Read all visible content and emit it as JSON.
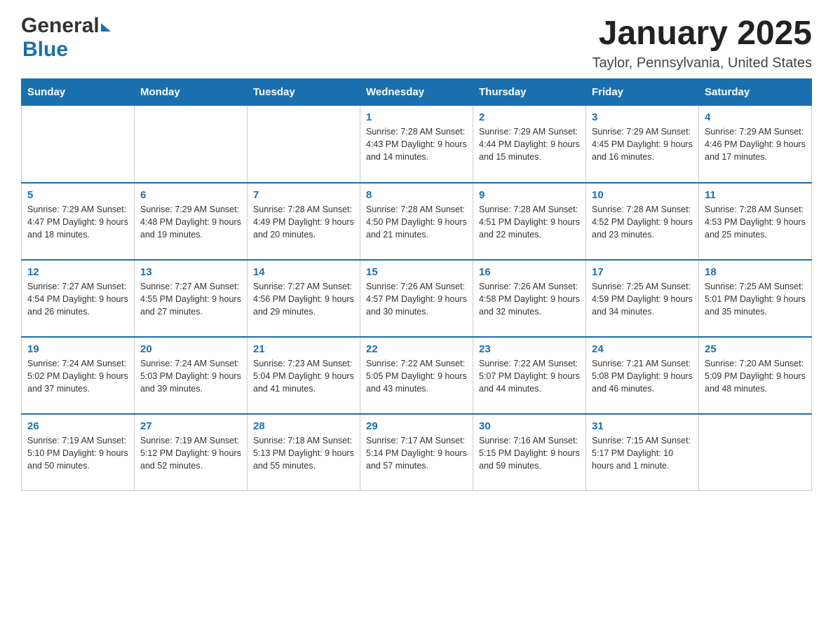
{
  "header": {
    "title": "January 2025",
    "subtitle": "Taylor, Pennsylvania, United States",
    "logo_general": "General",
    "logo_blue": "Blue"
  },
  "weekdays": [
    "Sunday",
    "Monday",
    "Tuesday",
    "Wednesday",
    "Thursday",
    "Friday",
    "Saturday"
  ],
  "weeks": [
    [
      {
        "day": "",
        "info": ""
      },
      {
        "day": "",
        "info": ""
      },
      {
        "day": "",
        "info": ""
      },
      {
        "day": "1",
        "info": "Sunrise: 7:28 AM\nSunset: 4:43 PM\nDaylight: 9 hours\nand 14 minutes."
      },
      {
        "day": "2",
        "info": "Sunrise: 7:29 AM\nSunset: 4:44 PM\nDaylight: 9 hours\nand 15 minutes."
      },
      {
        "day": "3",
        "info": "Sunrise: 7:29 AM\nSunset: 4:45 PM\nDaylight: 9 hours\nand 16 minutes."
      },
      {
        "day": "4",
        "info": "Sunrise: 7:29 AM\nSunset: 4:46 PM\nDaylight: 9 hours\nand 17 minutes."
      }
    ],
    [
      {
        "day": "5",
        "info": "Sunrise: 7:29 AM\nSunset: 4:47 PM\nDaylight: 9 hours\nand 18 minutes."
      },
      {
        "day": "6",
        "info": "Sunrise: 7:29 AM\nSunset: 4:48 PM\nDaylight: 9 hours\nand 19 minutes."
      },
      {
        "day": "7",
        "info": "Sunrise: 7:28 AM\nSunset: 4:49 PM\nDaylight: 9 hours\nand 20 minutes."
      },
      {
        "day": "8",
        "info": "Sunrise: 7:28 AM\nSunset: 4:50 PM\nDaylight: 9 hours\nand 21 minutes."
      },
      {
        "day": "9",
        "info": "Sunrise: 7:28 AM\nSunset: 4:51 PM\nDaylight: 9 hours\nand 22 minutes."
      },
      {
        "day": "10",
        "info": "Sunrise: 7:28 AM\nSunset: 4:52 PM\nDaylight: 9 hours\nand 23 minutes."
      },
      {
        "day": "11",
        "info": "Sunrise: 7:28 AM\nSunset: 4:53 PM\nDaylight: 9 hours\nand 25 minutes."
      }
    ],
    [
      {
        "day": "12",
        "info": "Sunrise: 7:27 AM\nSunset: 4:54 PM\nDaylight: 9 hours\nand 26 minutes."
      },
      {
        "day": "13",
        "info": "Sunrise: 7:27 AM\nSunset: 4:55 PM\nDaylight: 9 hours\nand 27 minutes."
      },
      {
        "day": "14",
        "info": "Sunrise: 7:27 AM\nSunset: 4:56 PM\nDaylight: 9 hours\nand 29 minutes."
      },
      {
        "day": "15",
        "info": "Sunrise: 7:26 AM\nSunset: 4:57 PM\nDaylight: 9 hours\nand 30 minutes."
      },
      {
        "day": "16",
        "info": "Sunrise: 7:26 AM\nSunset: 4:58 PM\nDaylight: 9 hours\nand 32 minutes."
      },
      {
        "day": "17",
        "info": "Sunrise: 7:25 AM\nSunset: 4:59 PM\nDaylight: 9 hours\nand 34 minutes."
      },
      {
        "day": "18",
        "info": "Sunrise: 7:25 AM\nSunset: 5:01 PM\nDaylight: 9 hours\nand 35 minutes."
      }
    ],
    [
      {
        "day": "19",
        "info": "Sunrise: 7:24 AM\nSunset: 5:02 PM\nDaylight: 9 hours\nand 37 minutes."
      },
      {
        "day": "20",
        "info": "Sunrise: 7:24 AM\nSunset: 5:03 PM\nDaylight: 9 hours\nand 39 minutes."
      },
      {
        "day": "21",
        "info": "Sunrise: 7:23 AM\nSunset: 5:04 PM\nDaylight: 9 hours\nand 41 minutes."
      },
      {
        "day": "22",
        "info": "Sunrise: 7:22 AM\nSunset: 5:05 PM\nDaylight: 9 hours\nand 43 minutes."
      },
      {
        "day": "23",
        "info": "Sunrise: 7:22 AM\nSunset: 5:07 PM\nDaylight: 9 hours\nand 44 minutes."
      },
      {
        "day": "24",
        "info": "Sunrise: 7:21 AM\nSunset: 5:08 PM\nDaylight: 9 hours\nand 46 minutes."
      },
      {
        "day": "25",
        "info": "Sunrise: 7:20 AM\nSunset: 5:09 PM\nDaylight: 9 hours\nand 48 minutes."
      }
    ],
    [
      {
        "day": "26",
        "info": "Sunrise: 7:19 AM\nSunset: 5:10 PM\nDaylight: 9 hours\nand 50 minutes."
      },
      {
        "day": "27",
        "info": "Sunrise: 7:19 AM\nSunset: 5:12 PM\nDaylight: 9 hours\nand 52 minutes."
      },
      {
        "day": "28",
        "info": "Sunrise: 7:18 AM\nSunset: 5:13 PM\nDaylight: 9 hours\nand 55 minutes."
      },
      {
        "day": "29",
        "info": "Sunrise: 7:17 AM\nSunset: 5:14 PM\nDaylight: 9 hours\nand 57 minutes."
      },
      {
        "day": "30",
        "info": "Sunrise: 7:16 AM\nSunset: 5:15 PM\nDaylight: 9 hours\nand 59 minutes."
      },
      {
        "day": "31",
        "info": "Sunrise: 7:15 AM\nSunset: 5:17 PM\nDaylight: 10 hours\nand 1 minute."
      },
      {
        "day": "",
        "info": ""
      }
    ]
  ]
}
